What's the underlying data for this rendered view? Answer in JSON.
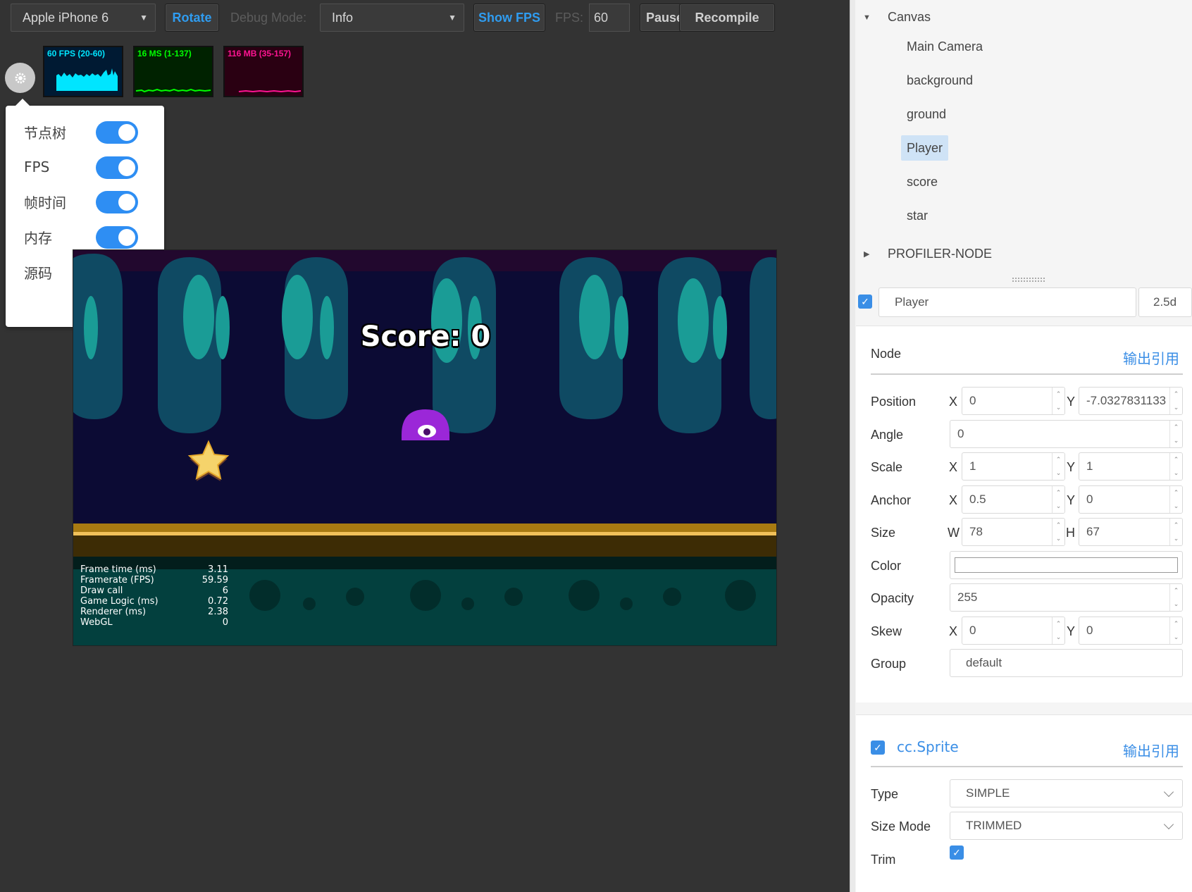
{
  "toolbar": {
    "device": "Apple iPhone 6",
    "rotate": "Rotate",
    "debug_label": "Debug Mode:",
    "debug_value": "Info",
    "show_fps": "Show FPS",
    "fps_label": "FPS:",
    "fps_value": "60",
    "pause": "Pause",
    "recompile": "Recompile"
  },
  "profiler": {
    "fps_graph": "60 FPS (20-60)",
    "ms_graph": "16 MS (1-137)",
    "mem_graph": "116 MB (35-157)",
    "toggles": [
      {
        "label": "节点树",
        "on": true
      },
      {
        "label": "FPS",
        "on": true
      },
      {
        "label": "帧时间",
        "on": true
      },
      {
        "label": "内存",
        "on": true
      }
    ],
    "source_label": "源码",
    "source_icon": "github-icon"
  },
  "game": {
    "score": "Score: 0",
    "stats": [
      {
        "k": "Frame time (ms)",
        "v": "3.11"
      },
      {
        "k": "Framerate (FPS)",
        "v": "59.59"
      },
      {
        "k": "Draw call",
        "v": "6"
      },
      {
        "k": "Game Logic (ms)",
        "v": "0.72"
      },
      {
        "k": "Renderer (ms)",
        "v": "2.38"
      },
      {
        "k": "WebGL",
        "v": "0"
      }
    ]
  },
  "tree": {
    "root": "Canvas",
    "children": [
      "Main Camera",
      "background",
      "ground",
      "Player",
      "score",
      "star"
    ],
    "selected": "Player",
    "profiler_node": "PROFILER-NODE"
  },
  "inspector": {
    "node_name": "Player",
    "node_mode": "2.5d",
    "node_section": "Node",
    "export_ref": "输出引用",
    "position_label": "Position",
    "position_x": "0",
    "position_y": "-7.0327831133",
    "angle_label": "Angle",
    "angle": "0",
    "scale_label": "Scale",
    "scale_x": "1",
    "scale_y": "1",
    "anchor_label": "Anchor",
    "anchor_x": "0.5",
    "anchor_y": "0",
    "size_label": "Size",
    "size_w": "78",
    "size_h": "67",
    "color_label": "Color",
    "opacity_label": "Opacity",
    "opacity": "255",
    "skew_label": "Skew",
    "skew_x": "0",
    "skew_y": "0",
    "group_label": "Group",
    "group": "default",
    "axis_x": "X",
    "axis_y": "Y",
    "axis_w": "W",
    "axis_h": "H",
    "sprite_title": "cc.Sprite",
    "type_label": "Type",
    "type_value": "SIMPLE",
    "sizemode_label": "Size Mode",
    "sizemode_value": "TRIMMED",
    "trim_label": "Trim",
    "trim": true
  },
  "colors": {
    "accent": "#3a8ee6",
    "fps_graph": "#00e5ff",
    "ms_graph": "#00ff00",
    "mem_graph": "#ff1493"
  }
}
